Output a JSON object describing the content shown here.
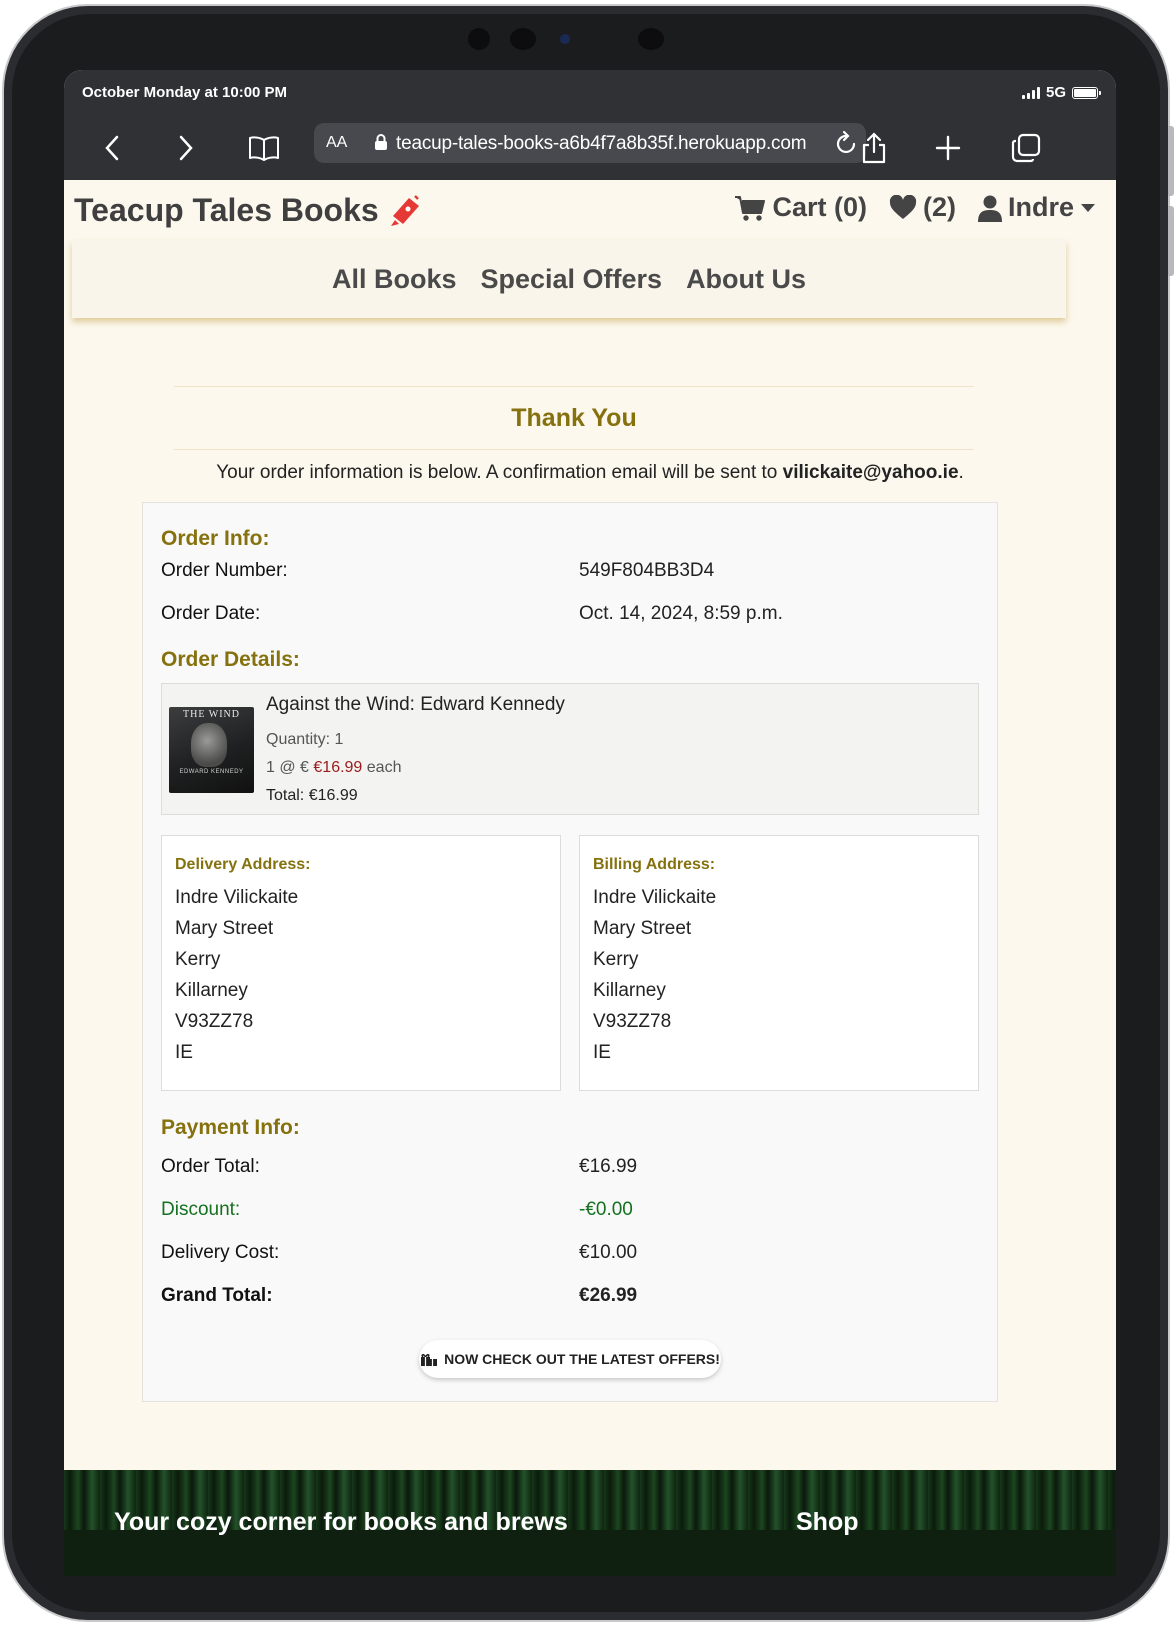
{
  "device": {
    "status_time": "October Monday at 10:00 PM",
    "network": "5G"
  },
  "browser": {
    "aa_label": "AA",
    "url": "teacup-tales-books-a6b4f7a8b35f.herokuapp.com"
  },
  "site": {
    "brand": "Teacup Tales Books",
    "cart_label": "Cart (0)",
    "wishlist_count": "(2)",
    "user_name": "Indre",
    "nav": [
      "All Books",
      "Special Offers",
      "About Us"
    ]
  },
  "confirmation": {
    "heading": "Thank You",
    "intro_text": "Your order information is below. A confirmation email will be sent to",
    "email": "vilickaite@yahoo.ie",
    "order_info_title": "Order Info:",
    "order_number_label": "Order Number:",
    "order_number": "549F804BB3D4",
    "order_date_label": "Order Date:",
    "order_date": "Oct. 14, 2024, 8:59 p.m.",
    "order_details_title": "Order Details:",
    "item": {
      "cover_text": "THE WIND",
      "cover_name": "EDWARD KENNEDY",
      "title": "Against the Wind: Edward Kennedy",
      "quantity": "Quantity: 1",
      "price_prefix": "1 @ €",
      "price": "€16.99",
      "price_suffix": "each",
      "total": "Total: €16.99"
    },
    "delivery": {
      "title": "Delivery Address:",
      "lines": [
        "Indre Vilickaite",
        "Mary Street",
        "Kerry",
        "Killarney",
        "V93ZZ78",
        "IE"
      ]
    },
    "billing": {
      "title": "Billing Address:",
      "lines": [
        "Indre Vilickaite",
        "Mary Street",
        "Kerry",
        "Killarney",
        "V93ZZ78",
        "IE"
      ]
    },
    "payment_title": "Payment Info:",
    "order_total_label": "Order Total:",
    "order_total": "€16.99",
    "discount_label": "Discount:",
    "discount": "-€0.00",
    "delivery_cost_label": "Delivery Cost:",
    "delivery_cost": "€10.00",
    "grand_total_label": "Grand Total:",
    "grand_total": "€26.99",
    "offers_button": "Now check out the latest offers!"
  },
  "footer": {
    "left_text": "Your cozy corner for books and brews",
    "right_text": "Shop"
  },
  "colors": {
    "accent_gold": "#85720f",
    "discount_green": "#15701f",
    "price_red": "#9a1b1b",
    "page_bg": "#fcf8ee"
  }
}
